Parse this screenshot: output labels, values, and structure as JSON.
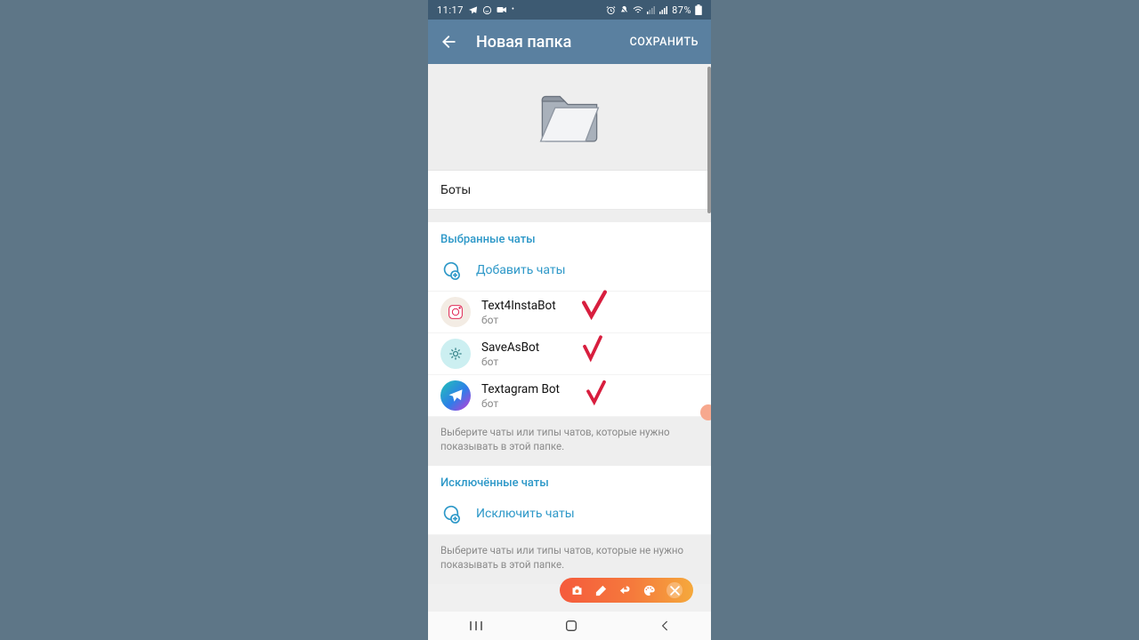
{
  "status": {
    "time": "11:17",
    "battery": "87%"
  },
  "appbar": {
    "title": "Новая папка",
    "save": "СОХРАНИТЬ"
  },
  "folder_name": "Боты",
  "selected": {
    "header": "Выбранные чаты",
    "add": "Добавить чаты",
    "chats": [
      {
        "name": "Text4InstaBot",
        "sub": "бот"
      },
      {
        "name": "SaveAsBot",
        "sub": "бот"
      },
      {
        "name": "Textagram Bot",
        "sub": "бот"
      }
    ],
    "hint": "Выберите чаты или типы чатов, которые нужно показывать в этой папке."
  },
  "excluded": {
    "header": "Исключённые чаты",
    "add": "Исключить чаты",
    "hint": "Выберите чаты или типы чатов, которые не нужно показывать в этой папке."
  }
}
